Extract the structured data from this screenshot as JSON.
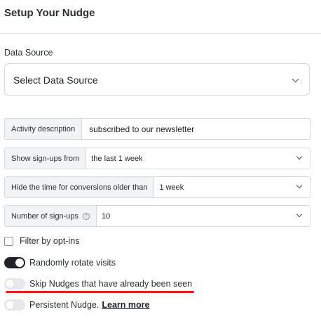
{
  "panel": {
    "title": "Setup Your Nudge"
  },
  "data_source": {
    "label": "Data Source",
    "selected": "Select Data Source"
  },
  "fields": {
    "activity_description": {
      "label": "Activity description",
      "value": "subscribed to our newsletter"
    },
    "show_signups_from": {
      "label": "Show sign-ups from",
      "value": "the last 1 week"
    },
    "hide_time": {
      "label": "Hide the time for conversions older than",
      "value": "1 week"
    },
    "number_of_signups": {
      "label": "Number of sign-ups",
      "help": "?",
      "value": "10"
    }
  },
  "options": {
    "filter_optins": {
      "label": "Filter by opt-ins",
      "checked": false
    },
    "randomly_rotate": {
      "label": "Randomly rotate visits",
      "on": true
    },
    "skip_seen": {
      "label": "Skip Nudges that have already been seen",
      "on": false
    },
    "persistent": {
      "label": "Persistent Nudge.",
      "link": "Learn more",
      "on": false
    }
  },
  "annotation": {
    "underline_color": "#e01f1f"
  }
}
